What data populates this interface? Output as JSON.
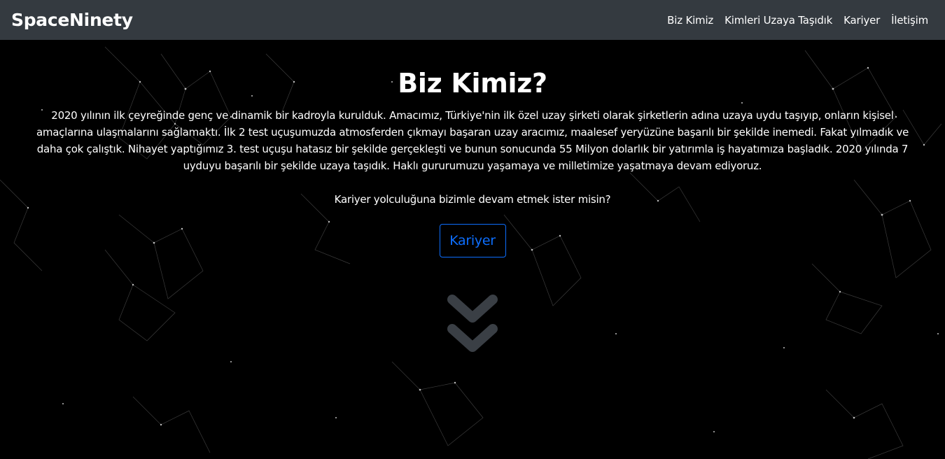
{
  "navbar": {
    "brand": "SpaceNinety",
    "links": [
      "Biz Kimiz",
      "Kimleri Uzaya Taşıdık",
      "Kariyer",
      "İletişim"
    ]
  },
  "hero": {
    "title": "Biz Kimiz?",
    "paragraph": "2020 yılının ilk çeyreğinde genç ve dinamik bir kadroyla kurulduk. Amacımız, Türkiye'nin ilk özel uzay şirketi olarak şirketlerin adına uzaya uydu taşıyıp, onların kişisel amaçlarına ulaşmalarını sağlamaktı. İlk 2 test uçuşumuzda atmosferden çıkmayı başaran uzay aracımız, maalesef yeryüzüne başarılı bir şekilde inemedi. Fakat yılmadık ve daha çok çalıştık. Nihayet yaptığımız 3. test uçuşu hatasız bir şekilde gerçekleşti ve bunun sonucunda 55 Milyon dolarlık bir yatırımla iş hayatımıza başladık. 2020 yılında 7 uyduyu başarılı bir şekilde uzaya taşıdık. Haklı gururumuzu yaşamaya ve milletimize yaşatmaya devam ediyoruz.",
    "question": "Kariyer yolculuğuna bizimle devam etmek ister misin?",
    "button_label": "Kariyer",
    "scroll_icon": "double-chevron-down-icon"
  },
  "colors": {
    "navbar_bg": "#343a40",
    "page_bg": "#000000",
    "accent": "#0d6efd",
    "chevron": "#3a3f45"
  }
}
